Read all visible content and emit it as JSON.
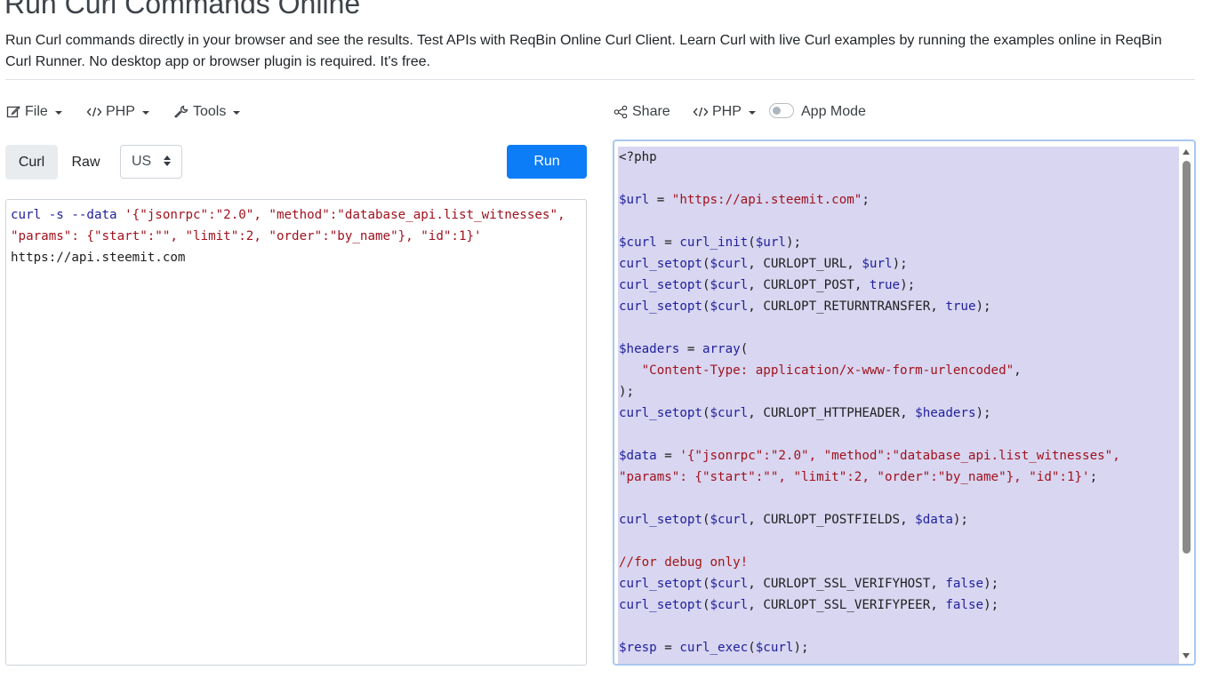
{
  "page": {
    "title": "Run Curl Commands Online",
    "description": "Run Curl commands directly in your browser and see the results. Test APIs with ReqBin Online Curl Client. Learn Curl with live Curl examples by running the examples online in ReqBin Curl Runner. No desktop app or browser plugin is required. It's free."
  },
  "toolbar_left": {
    "file": "File",
    "php": "PHP",
    "tools": "Tools"
  },
  "toolbar_right": {
    "share": "Share",
    "php": "PHP",
    "app_mode": "App Mode",
    "app_mode_on": false
  },
  "controls": {
    "tab_curl": "Curl",
    "tab_raw": "Raw",
    "region": "US",
    "run": "Run"
  },
  "curl_editor": {
    "line1_cmd": "curl -s --data ",
    "line1_str": "'{\"jsonrpc\":\"2.0\", \"method\":\"database_api.list_witnesses\",",
    "line2_str": "\"params\": {\"start\":\"\", \"limit\":2, \"order\":\"by_name\"}, \"id\":1}'",
    "line3_url": "https://api.steemit.com"
  },
  "php_code": {
    "l1": "<?php",
    "l3_var": "$url",
    "l3_eq": " = ",
    "l3_str": "\"https://api.steemit.com\"",
    "l3_end": ";",
    "l5_var": "$curl",
    "l5_eq": " = ",
    "l5_fn": "curl_init",
    "l5_arg": "$url",
    "l6": "CURLOPT_URL",
    "l7": "CURLOPT_POST",
    "l8": "CURLOPT_RETURNTRANSFER",
    "l10_var": "$headers",
    "l10_fn": "array",
    "l11_str": "\"Content-Type: application/x-www-form-urlencoded\"",
    "l13": "CURLOPT_HTTPHEADER",
    "l13_arg": "$headers",
    "l15_var": "$data",
    "l15_str": "'{\"jsonrpc\":\"2.0\", \"method\":\"database_api.list_witnesses\",",
    "l16_str": "\"params\": {\"start\":\"\", \"limit\":2, \"order\":\"by_name\"}, \"id\":1}'",
    "l18": "CURLOPT_POSTFIELDS",
    "l18_arg": "$data",
    "l20_comment": "//for debug only!",
    "l21": "CURLOPT_SSL_VERIFYHOST",
    "l22": "CURLOPT_SSL_VERIFYPEER",
    "l24_var": "$resp",
    "l24_fn": "curl_exec",
    "setopt": "curl_setopt",
    "curl_var": "$curl",
    "true": "true",
    "false": "false"
  },
  "colors": {
    "run_button": "#0d7cf7",
    "selection": "#d8d6f0"
  }
}
